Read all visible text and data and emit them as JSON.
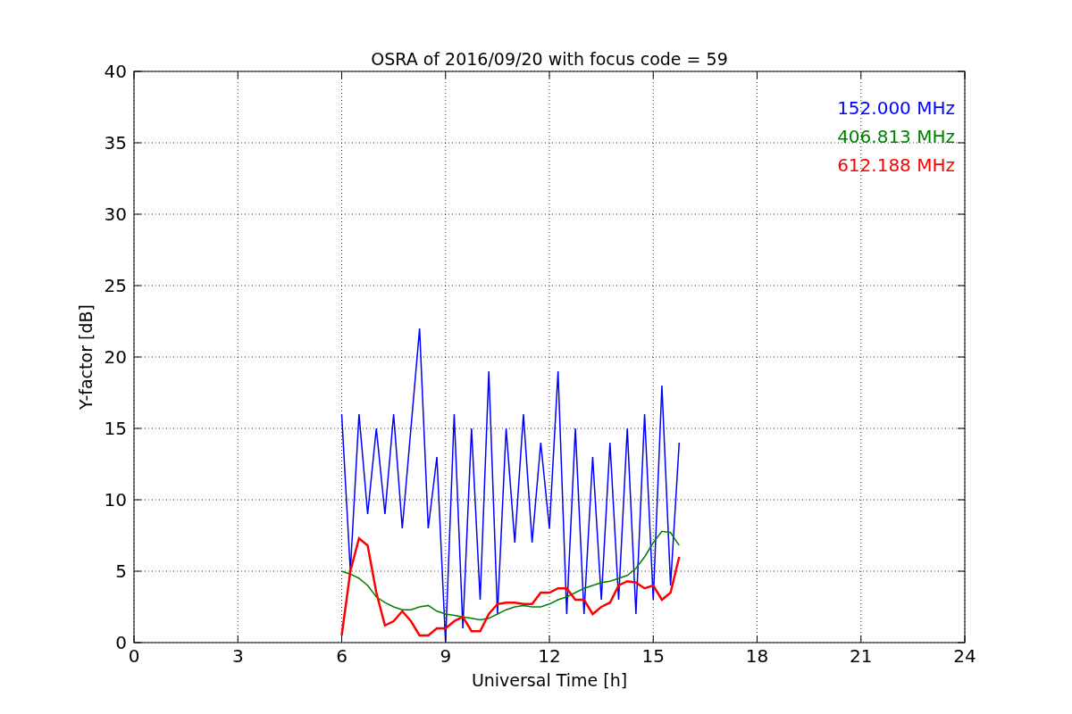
{
  "chart_data": {
    "type": "line",
    "title": "OSRA of 2016/09/20 with focus code = 59",
    "xlabel": "Universal Time [h]",
    "ylabel": "Y-factor [dB]",
    "x": [
      6,
      6.25,
      6.5,
      6.75,
      7,
      7.25,
      7.5,
      7.75,
      8,
      8.25,
      8.5,
      8.75,
      9,
      9.25,
      9.5,
      9.75,
      10,
      10.25,
      10.5,
      10.75,
      11,
      11.25,
      11.5,
      11.75,
      12,
      12.25,
      12.5,
      12.75,
      13,
      13.25,
      13.5,
      13.75,
      14,
      14.25,
      14.5,
      14.75,
      15,
      15.25,
      15.5,
      15.75
    ],
    "series": [
      {
        "name": "152.000 MHz",
        "color": "#0000ff",
        "values": [
          16,
          5,
          16,
          9,
          15,
          9,
          16,
          8,
          15,
          22,
          8,
          13,
          0,
          16,
          1,
          15,
          3,
          19,
          2,
          15,
          7,
          16,
          7,
          14,
          8,
          19,
          2,
          15,
          2,
          13,
          3,
          14,
          3,
          15,
          2,
          16,
          3,
          18,
          4,
          14
        ]
      },
      {
        "name": "406.813 MHz",
        "color": "#008000",
        "values": [
          5,
          4.8,
          4.5,
          4,
          3.2,
          2.8,
          2.5,
          2.3,
          2.3,
          2.5,
          2.6,
          2.2,
          2,
          1.9,
          1.8,
          1.7,
          1.6,
          1.7,
          2,
          2.3,
          2.5,
          2.6,
          2.5,
          2.5,
          2.7,
          3,
          3.2,
          3.5,
          3.8,
          4,
          4.2,
          4.3,
          4.5,
          4.7,
          5.2,
          6,
          7,
          7.8,
          7.7,
          6.8
        ]
      },
      {
        "name": "612.188 MHz",
        "color": "#ff0000",
        "values": [
          0.5,
          5,
          7.3,
          6.8,
          3.5,
          1.2,
          1.5,
          2.2,
          1.5,
          0.5,
          0.5,
          1,
          1,
          1.5,
          1.8,
          0.8,
          0.8,
          2,
          2.7,
          2.8,
          2.8,
          2.7,
          2.7,
          3.5,
          3.5,
          3.8,
          3.8,
          3,
          3,
          2,
          2.5,
          2.8,
          4,
          4.3,
          4.2,
          3.8,
          4,
          3,
          3.5,
          6
        ]
      }
    ],
    "grid": true,
    "xlim": [
      0,
      24
    ],
    "ylim": [
      0,
      40
    ],
    "xticks": [
      0,
      3,
      6,
      9,
      12,
      15,
      18,
      21,
      24
    ],
    "yticks": [
      0,
      5,
      10,
      15,
      20,
      25,
      30,
      35,
      40
    ]
  }
}
